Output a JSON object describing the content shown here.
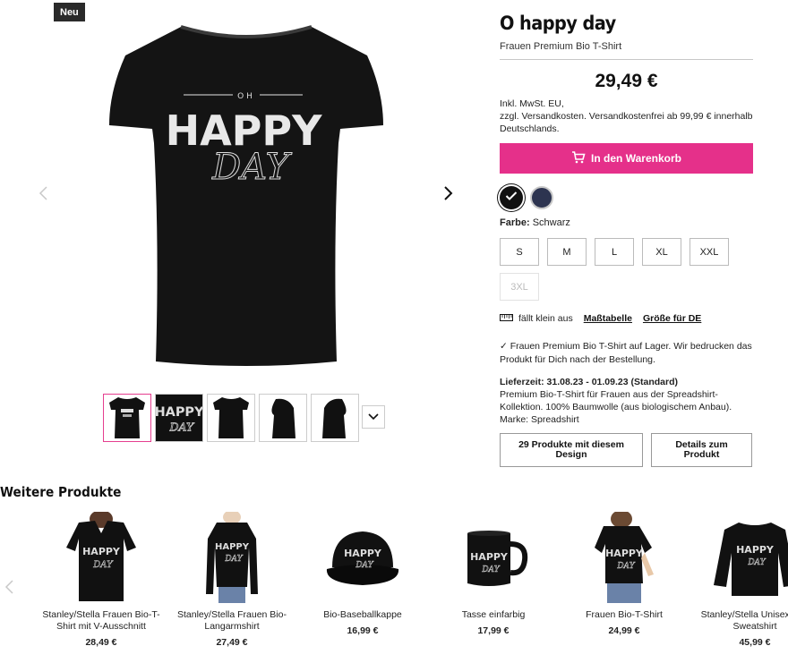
{
  "badge": "Neu",
  "design": {
    "line1": "OH",
    "line2": "HAPPY",
    "line3": "DAY"
  },
  "product": {
    "title": "O happy day",
    "subtitle": "Frauen Premium Bio T-Shirt",
    "price": "29,49 €",
    "tax_lines": [
      "Inkl. MwSt. EU,",
      "zzgl. Versandkosten. Versandkostenfrei ab 99,99 € innerhalb Deutschlands."
    ],
    "cart_button": "In den Warenkorb",
    "colors": [
      "black",
      "navy"
    ],
    "color_label_key": "Farbe:",
    "color_label_value": "Schwarz",
    "sizes": [
      "S",
      "M",
      "L",
      "XL",
      "XXL",
      "3XL"
    ],
    "fit_note": "fällt klein aus",
    "size_chart_link": "Maßtabelle",
    "size_de_link": "Größe für DE",
    "stock_text": "Frauen Premium Bio T-Shirt auf Lager. Wir bedrucken das Produkt für Dich nach der Bestellung.",
    "delivery_label": "Lieferzeit: 31.08.23 - 01.09.23 (Standard)",
    "description": "Premium Bio-T-Shirt für Frauen aus der Spreadshirt-Kollektion. 100% Baumwolle (aus biologischem Anbau). Marke: Spreadshirt",
    "btn_products_design": "29 Produkte mit diesem Design",
    "btn_details": "Details zum Produkt"
  },
  "more_products": {
    "title": "Weitere Produkte",
    "items": [
      {
        "name": "Stanley/Stella Frauen Bio-T-Shirt mit V-Ausschnitt",
        "price": "28,49 €"
      },
      {
        "name": "Stanley/Stella Frauen Bio-Langarmshirt",
        "price": "27,49 €"
      },
      {
        "name": "Bio-Baseballkappe",
        "price": "16,99 €"
      },
      {
        "name": "Tasse einfarbig",
        "price": "17,99 €"
      },
      {
        "name": "Frauen Bio-T-Shirt",
        "price": "24,99 €"
      },
      {
        "name": "Stanley/Stella Unisex Bio-Sweatshirt",
        "price": "45,99 €"
      }
    ]
  },
  "colors": {
    "accent": "#e5308a",
    "shirt": "#111111",
    "navy": "#2d3450"
  }
}
